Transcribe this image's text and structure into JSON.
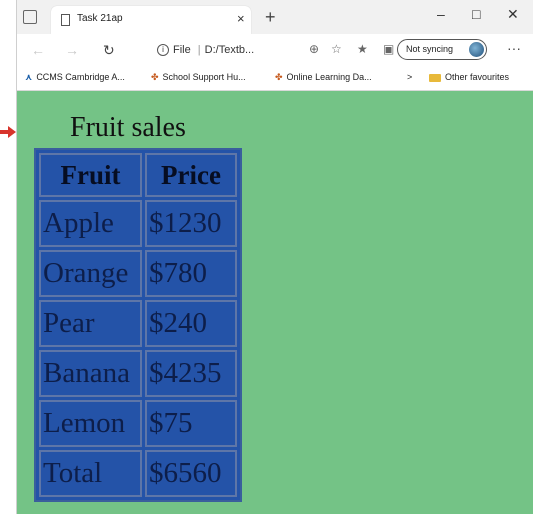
{
  "browser": {
    "tab_title": "Task 21ap",
    "tab_close": "×",
    "new_tab": "+",
    "window": {
      "minimize": "–",
      "maximize": "□",
      "close": "✕"
    },
    "address": {
      "scheme_label": "File",
      "path": "D:/Textb..."
    },
    "sync_label": "Not syncing",
    "more": "···",
    "favourites": [
      {
        "label": "CCMS Cambridge A...",
        "icon": "ccms-logo-icon"
      },
      {
        "label": "School Support Hu...",
        "icon": "paw-icon"
      },
      {
        "label": "Online Learning Da...",
        "icon": "paw-icon"
      }
    ],
    "fav_chevron": ">",
    "other_favourites": "Other favourites"
  },
  "page": {
    "heading": "Fruit sales",
    "table": {
      "headers": [
        "Fruit",
        "Price"
      ],
      "rows": [
        [
          "Apple",
          "$1230"
        ],
        [
          "Orange",
          "$780"
        ],
        [
          "Pear",
          "$240"
        ],
        [
          "Banana",
          "$4235"
        ],
        [
          "Lemon",
          "$75"
        ],
        [
          "Total",
          "$6560"
        ]
      ]
    }
  },
  "colors": {
    "page_background": "#74c386",
    "table_background": "#2453a8",
    "arrow": "#d8342c"
  }
}
